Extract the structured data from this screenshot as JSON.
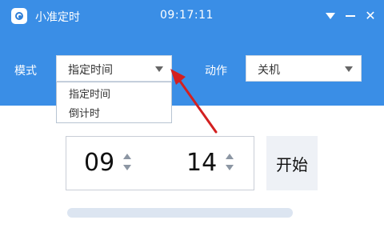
{
  "titlebar": {
    "app_name": "小准定时",
    "clock": "09:17:11",
    "icons": {
      "menu": "dropdown-triangle-icon",
      "minimize": "minimize-icon",
      "close": "close-icon"
    },
    "close_glyph": "✕"
  },
  "controls": {
    "mode_label": "模式",
    "mode_selected": "指定时间",
    "action_label": "动作",
    "action_selected": "关机",
    "mode_options": [
      "指定时间",
      "倒计时"
    ]
  },
  "timer": {
    "hours": "09",
    "minutes": "14",
    "start_label": "开始",
    "progress": 0
  },
  "colors": {
    "accent": "#3a8ee6",
    "annotation_arrow": "#d32020"
  }
}
